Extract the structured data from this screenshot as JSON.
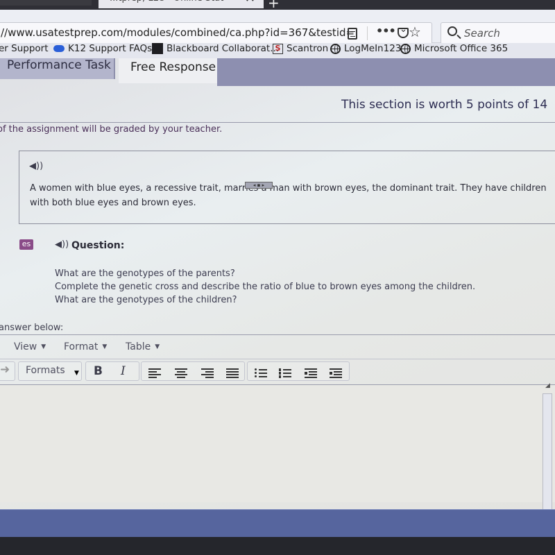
{
  "browser": {
    "tab_title": "...tprep, LLC - Online Stat",
    "url": "//www.usatestprep.com/modules/combined/ca.php?id=367&testid=",
    "search_placeholder": "Search",
    "icons": [
      "reader-view-icon",
      "more-icon",
      "pocket-icon",
      "star-icon",
      "search-icon"
    ]
  },
  "bookmarks": [
    {
      "label": "er Support",
      "icon": "none"
    },
    {
      "label": "K12 Support FAQs",
      "icon": "cloud-icon"
    },
    {
      "label": "Blackboard Collaborat...",
      "icon": "blackboard-icon"
    },
    {
      "label": "Scantron",
      "icon": "scantron-icon"
    },
    {
      "label": "LogMeIn123",
      "icon": "globe-icon"
    },
    {
      "label": "Microsoft Office 365",
      "icon": "globe-icon"
    }
  ],
  "page_tabs": {
    "performance": "Performance Task",
    "free_response": "Free Response",
    "active": "Free Response"
  },
  "header": {
    "worth": "This section is worth 5 points of 14",
    "graded_note": "of the assignment will be graded by your teacher."
  },
  "passage": {
    "text": "A women with blue eyes, a recessive trait, marries a man with brown eyes, the dominant trait. They have children with both blue eyes and brown eyes.",
    "speaker_icon": "speaker-icon"
  },
  "question": {
    "badge": "es",
    "label": "Question:",
    "lines": [
      "What are the genotypes of the parents?",
      "Complete the genetic cross and describe the ratio of blue to brown eyes among the children.",
      "What are the genotypes of the children?"
    ]
  },
  "answer": {
    "label": "answer below:",
    "menus": [
      "View",
      "Format",
      "Table"
    ],
    "formats_label": "Formats",
    "bold": "B",
    "italic": "I",
    "value": ""
  }
}
